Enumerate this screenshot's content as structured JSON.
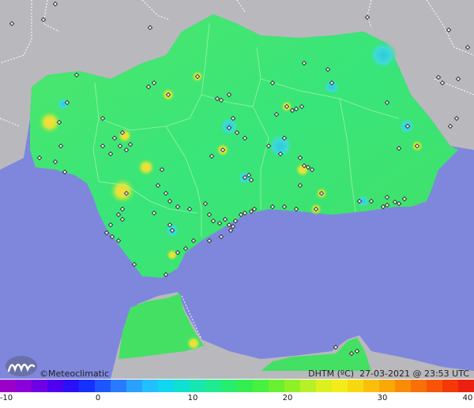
{
  "map": {
    "brand": "©Meteoclimatic",
    "variable_label": "DHTM (ºC)",
    "timestamp": "27-03-2021 @ 23:53 UTC",
    "colors": {
      "sea": "#7f87dc",
      "land_outside": "#b9b9bd",
      "region_fill": "#34e56a",
      "region_fill_light": "#56ee5c",
      "hot_spot": "#d8e53a",
      "cool_spot": "#3fdcd2",
      "border": "#ffffff",
      "station": "#222222"
    },
    "scale": {
      "ticks": [
        "-10",
        "0",
        "10",
        "20",
        "30",
        "40"
      ],
      "colors": [
        "#9a00c8",
        "#8a00d8",
        "#6e00e6",
        "#4f00f0",
        "#2a10f8",
        "#1530ff",
        "#1f55ff",
        "#2a7aff",
        "#2aa0ff",
        "#22c0ff",
        "#10d6f0",
        "#10e0d0",
        "#18e6b0",
        "#20ea90",
        "#28ec70",
        "#34ee50",
        "#48f040",
        "#6af030",
        "#90f028",
        "#b8f028",
        "#dcf020",
        "#f4ec18",
        "#f8d810",
        "#f8c00c",
        "#f8a808",
        "#f88c08",
        "#f87008",
        "#f85408",
        "#f43808",
        "#ec2010"
      ]
    }
  }
}
